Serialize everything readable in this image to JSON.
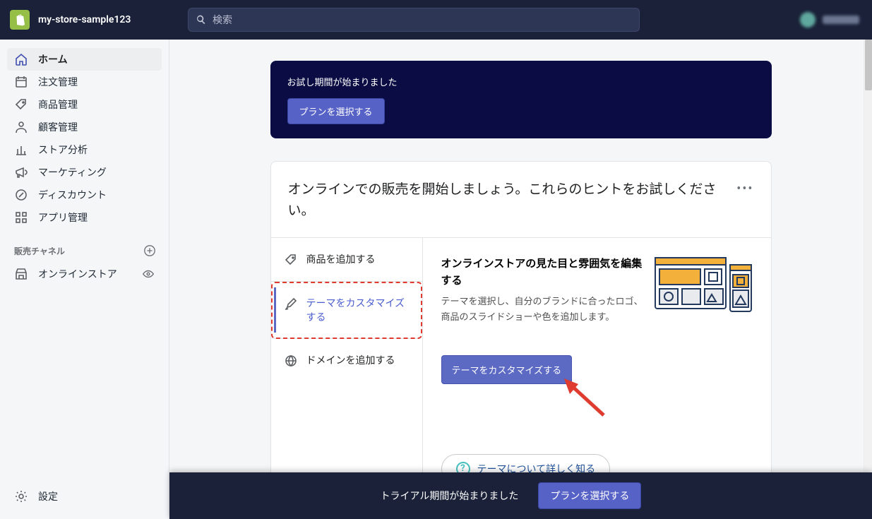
{
  "header": {
    "store_name": "my-store-sample123",
    "search_placeholder": "検索"
  },
  "sidebar": {
    "items": [
      {
        "label": "ホーム"
      },
      {
        "label": "注文管理"
      },
      {
        "label": "商品管理"
      },
      {
        "label": "顧客管理"
      },
      {
        "label": "ストア分析"
      },
      {
        "label": "マーケティング"
      },
      {
        "label": "ディスカウント"
      },
      {
        "label": "アプリ管理"
      }
    ],
    "channels_title": "販売チャネル",
    "channels": [
      {
        "label": "オンラインストア"
      }
    ],
    "settings_label": "設定"
  },
  "trial": {
    "message": "お試し期間が始まりました",
    "button": "プランを選択する"
  },
  "card": {
    "title": "オンラインでの販売を開始しましょう。これらのヒントをお試しください。",
    "setup_items": [
      {
        "label": "商品を追加する"
      },
      {
        "label": "テーマをカスタマイズする"
      },
      {
        "label": "ドメインを追加する"
      }
    ],
    "detail_title": "オンラインストアの見た目と雰囲気を編集する",
    "detail_desc": "テーマを選択し、自分のブランドに合ったロゴ、商品のスライドショーや色を追加します。",
    "action_button": "テーマをカスタマイズする",
    "learn_more": "テーマについて詳しく知る"
  },
  "bottom": {
    "text": "トライアル期間が始まりました",
    "button": "プランを選択する"
  }
}
